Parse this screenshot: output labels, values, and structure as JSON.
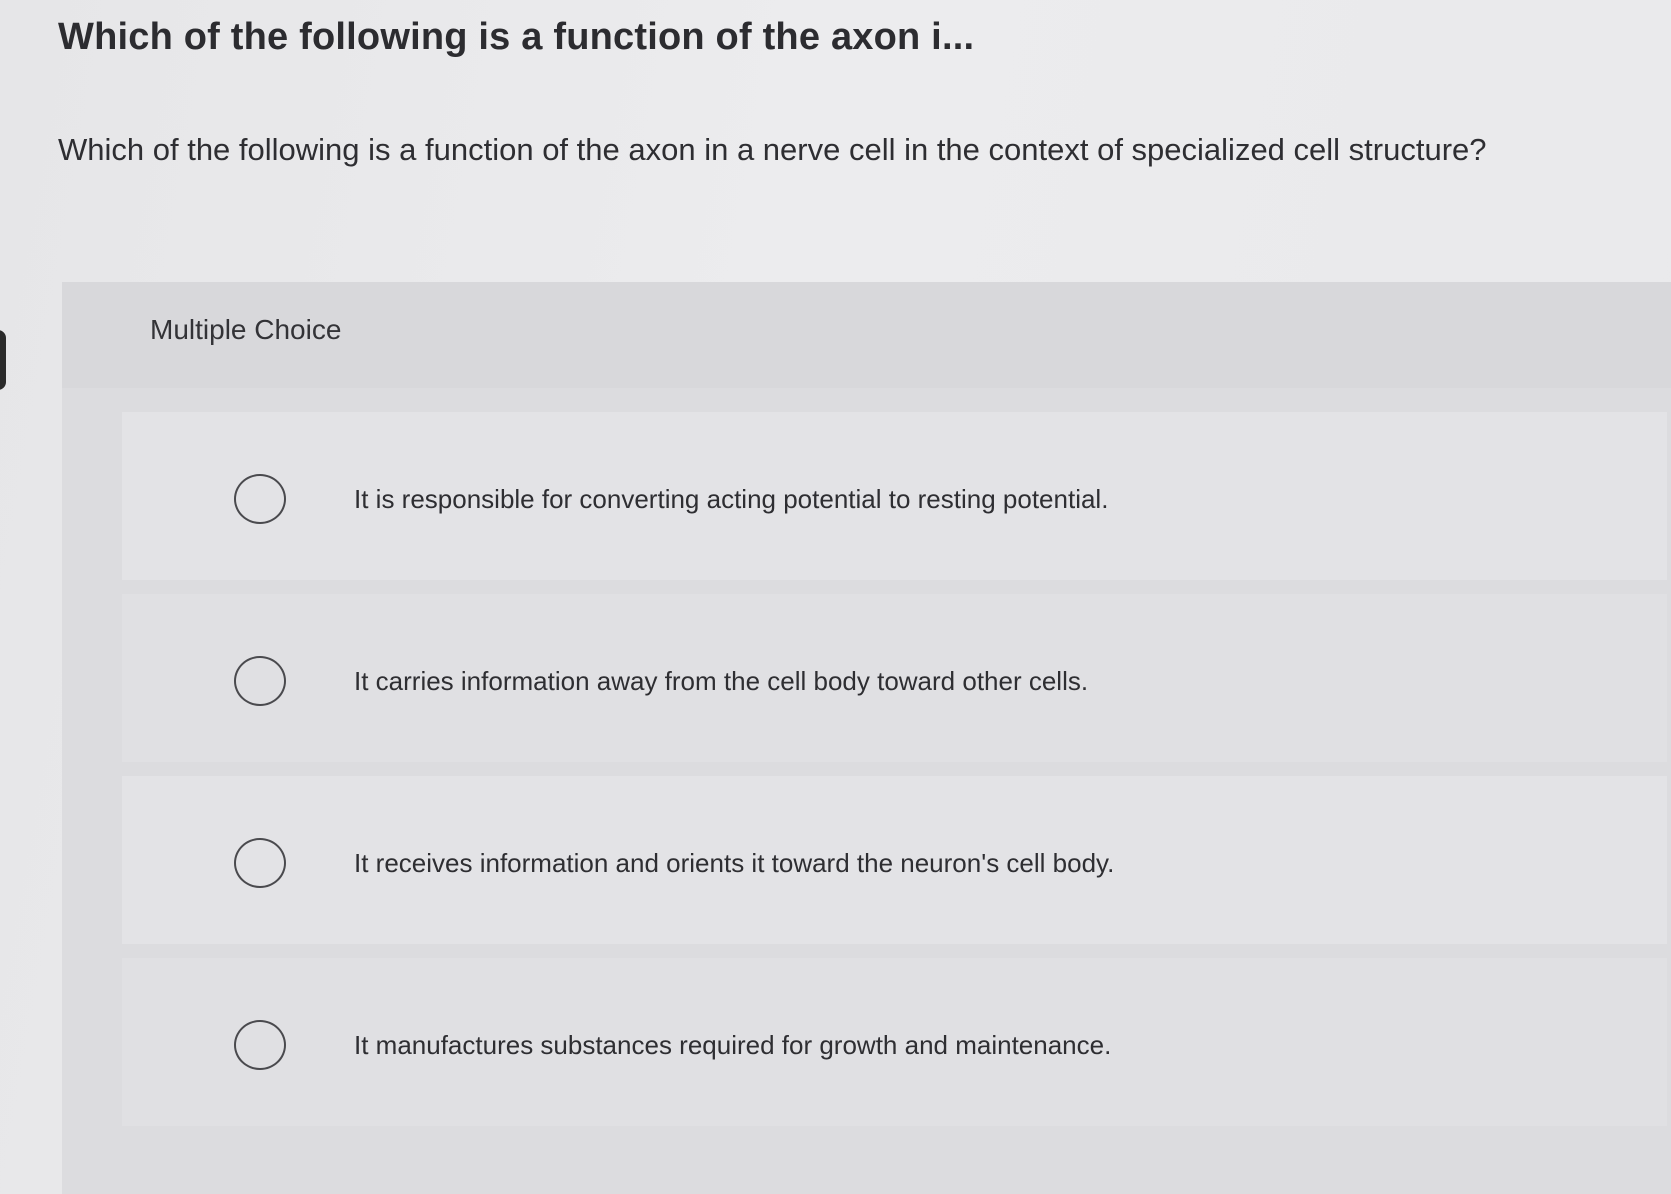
{
  "question": {
    "title": "Which of the following is a function of the axon i...",
    "text": "Which of the following is a function of the axon in a nerve cell in the context of specialized cell structure?"
  },
  "answer_panel": {
    "label": "Multiple Choice",
    "options": [
      {
        "text": "It is responsible for converting acting potential to resting potential.",
        "selected": false
      },
      {
        "text": "It carries information away from the cell body toward other cells.",
        "selected": false
      },
      {
        "text": "It receives information and orients it toward the neuron's cell body.",
        "selected": false
      },
      {
        "text": "It manufactures substances required for growth and maintenance.",
        "selected": false
      }
    ]
  }
}
